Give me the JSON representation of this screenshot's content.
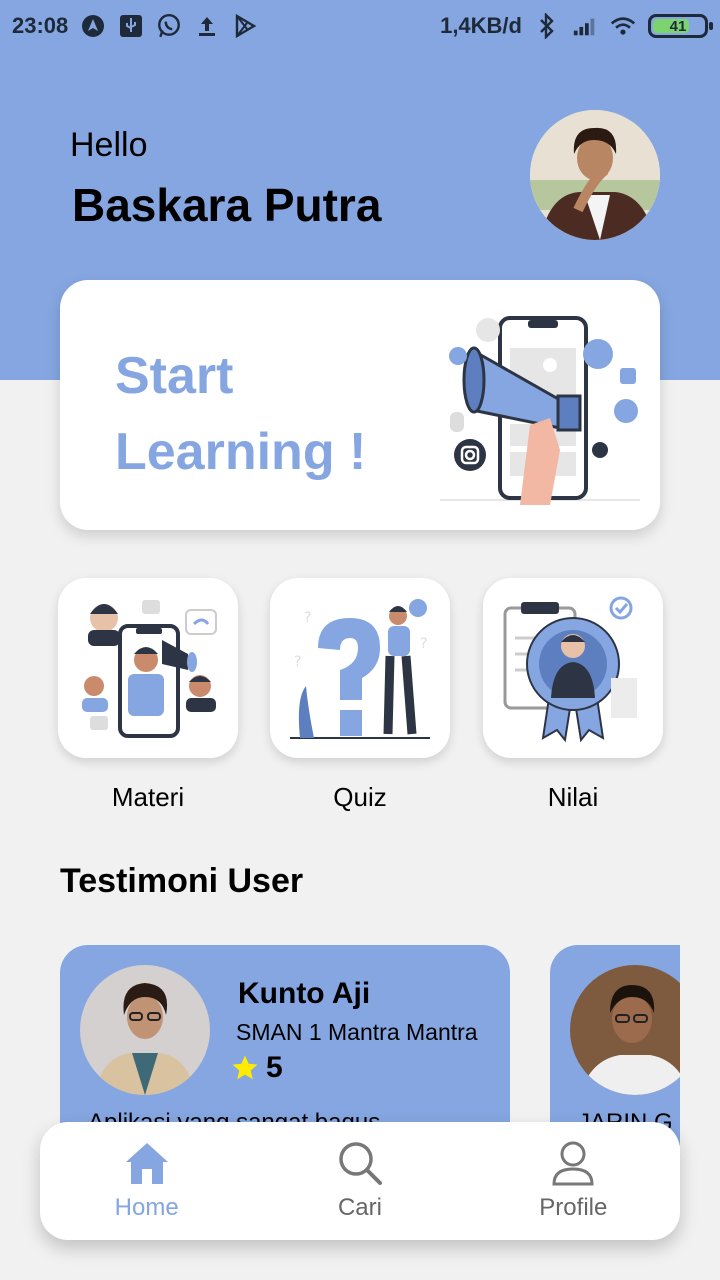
{
  "status_bar": {
    "time": "23:08",
    "network_speed": "1,4KB/d",
    "battery_level": "41",
    "icons": [
      "navigation-icon",
      "usb-icon",
      "whatsapp-icon",
      "upload-icon",
      "play-store-icon",
      "bluetooth-icon",
      "signal-icon",
      "wifi-icon",
      "battery-icon"
    ]
  },
  "greeting": {
    "hello": "Hello",
    "name": "Baskara Putra"
  },
  "hero": {
    "title": "Start Learning !"
  },
  "menu": [
    {
      "label": "Materi",
      "icon": "materi-illustration"
    },
    {
      "label": "Quiz",
      "icon": "quiz-illustration"
    },
    {
      "label": "Nilai",
      "icon": "nilai-illustration"
    }
  ],
  "testimonials_section": {
    "title": "Testimoni User"
  },
  "testimonials": [
    {
      "name": "Kunto Aji",
      "school": "SMAN 1 Mantra Mantra",
      "rating": "5",
      "text": "Aplikasi yang sangat bagus"
    },
    {
      "name": "",
      "school": "",
      "rating": "",
      "text": "JARIN G"
    }
  ],
  "bottom_nav": [
    {
      "label": "Home",
      "icon": "home-icon",
      "active": true
    },
    {
      "label": "Cari",
      "icon": "search-icon",
      "active": false
    },
    {
      "label": "Profile",
      "icon": "profile-icon",
      "active": false
    }
  ],
  "colors": {
    "primary": "#85a6e0",
    "background": "#f1f1f1",
    "card": "#ffffff",
    "star": "#ffeb00",
    "nav_inactive": "#666666"
  }
}
